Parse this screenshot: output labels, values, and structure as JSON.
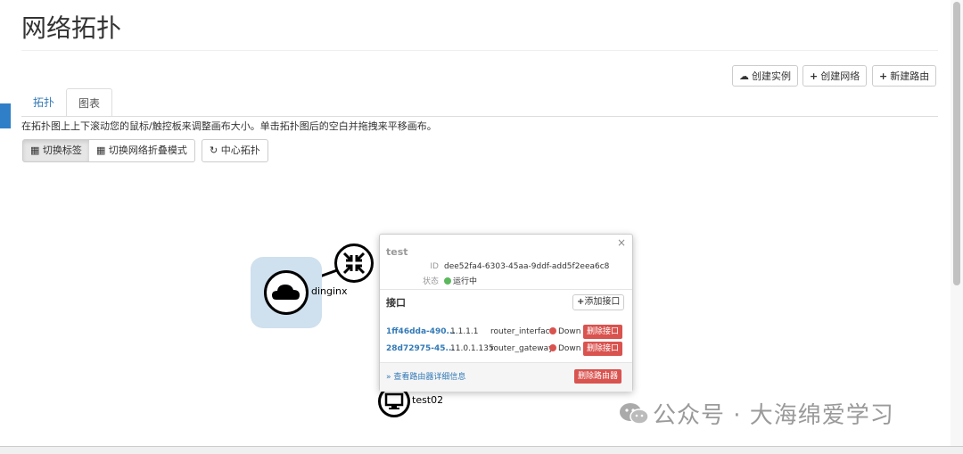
{
  "page": {
    "title": "网络拓扑"
  },
  "toolbar": {
    "create_instance": {
      "icon": "cloud-upload-icon",
      "glyph": "☁",
      "label": "创建实例"
    },
    "create_network": {
      "icon": "plus-icon",
      "glyph": "+",
      "label": "创建网络"
    },
    "create_router": {
      "icon": "plus-icon",
      "glyph": "+",
      "label": "新建路由"
    }
  },
  "tabs": [
    {
      "label": "拓扑",
      "active": true
    },
    {
      "label": "图表",
      "active": false
    }
  ],
  "help_text": "在拓扑图上上下滚动您的鼠标/触控板来调整画布大小。单击拓扑图后的空白并拖拽来平移画布。",
  "view_buttons": {
    "toggle_labels": {
      "icon": "th-large-icon",
      "glyph": "▦",
      "label": "切换标签"
    },
    "toggle_collapse": {
      "icon": "th-icon",
      "glyph": "▦",
      "label": "切换网络折叠模式"
    },
    "center": {
      "icon": "refresh-icon",
      "glyph": "↻",
      "label": "中心拓扑"
    }
  },
  "topology": {
    "network_label": "dinginx",
    "instance_label": "test02"
  },
  "popup": {
    "title": "test",
    "close": "×",
    "id_key": "ID",
    "id_value": "dee52fa4-6303-45aa-9ddf-add5f2eea6c8",
    "status_key": "状态",
    "status_value": "运行中",
    "status_color": "#5cb85c",
    "interfaces_heading": "接口",
    "add_interface": "添加接口",
    "interfaces": [
      {
        "id": "1ff46dda-490...",
        "ip": "1.1.1.1",
        "type": "router_interface",
        "status": "Down",
        "action": "删除接口"
      },
      {
        "id": "28d72975-45...",
        "ip": "11.0.1.135",
        "type": "router_gateway",
        "status": "Down",
        "action": "删除接口"
      }
    ],
    "down_color": "#d9534f",
    "view_details": "» 查看路由器详细信息",
    "delete_router": "删除路由器"
  },
  "watermark": "公众号 · 大海绵爱学习",
  "colors": {
    "link": "#337ab7",
    "danger": "#d9534f",
    "accent_tab": "#2f7fc8"
  }
}
